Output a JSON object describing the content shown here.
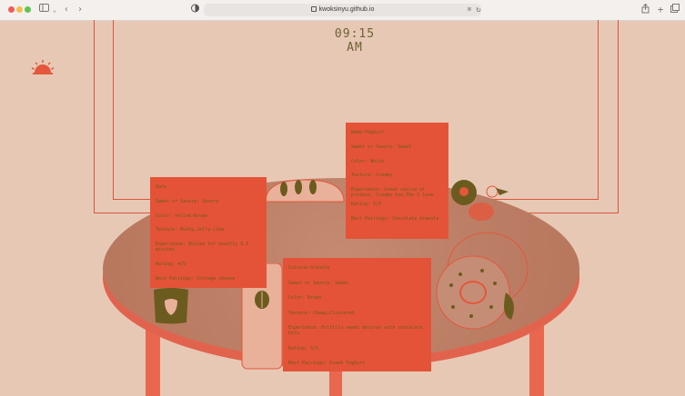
{
  "browser": {
    "url": "kwoksinyu.github.io",
    "sidebar_icon": "sidebar-icon",
    "back_icon": "chevron-left-icon",
    "forward_icon": "chevron-right-icon",
    "shield_icon": "shield-icon",
    "share_icon": "share-icon",
    "new_tab_icon": "plus-icon",
    "tabs_icon": "tabs-overview-icon"
  },
  "scene": {
    "clock": "09:15 AM",
    "colors": {
      "accent": "#e45337",
      "text": "#6c5b1e",
      "background": "#e7c8b5"
    }
  },
  "cards": [
    {
      "name": "Oats",
      "lines": [
        "Oats",
        "Sweet or Savory: Savory",
        "Color: Yellow-Brown",
        "Texture: Mushy,Jelly-like",
        "Experience: Boiled for exactly 6.5 minutes",
        "Rating: 4/5",
        "Best Pairings: Cottage cheese"
      ]
    },
    {
      "name": "Yoghurt",
      "lines": [
        "Name:Yoghurt",
        "Sweet or Savory: Sweet",
        "Color: White",
        "Texture: Creamy",
        "Experience: Great source of protein, Creamy too,Tho I love",
        "Rating: 5/5",
        "Best Pairings: Chocolate Granola"
      ]
    },
    {
      "name": "Granola",
      "lines": [
        "Cuisine:Granola",
        "Sweet or Savory: Sweet",
        "Color: Brown",
        "Texture: Chewy,Clustered",
        "Experience: Fulfills sweet desires with chocolate bits",
        "Rating: 5/5",
        "Best Pairings: Greek Yoghurt"
      ]
    }
  ]
}
